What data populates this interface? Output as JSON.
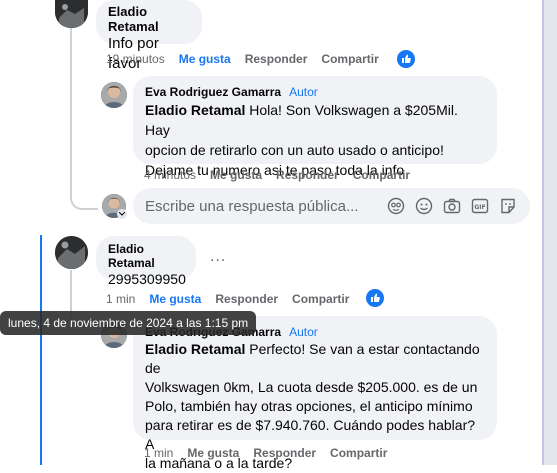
{
  "comments": [
    {
      "author": "Eladio Retamal",
      "text": "Info por favor",
      "time": "19 minutos",
      "like": "Me gusta",
      "reply": "Responder",
      "share": "Compartir"
    },
    {
      "author": "Eva Rodriguez Gamarra",
      "badge": "Autor",
      "mention": "Eladio Retamal",
      "text_lines": [
        " Hola! Son Volkswagen a $205Mil. Hay",
        "opcion de retirarlo con un auto usado o anticipo!",
        "Dejame tu numero asi te paso toda la info"
      ],
      "time": "4 minutos",
      "like": "Me gusta",
      "reply": "Responder",
      "share": "Compartir"
    },
    {
      "author": "Eladio Retamal",
      "text": "2995309950",
      "more": "...",
      "time": "1 min",
      "like": "Me gusta",
      "reply": "Responder",
      "share": "Compartir"
    },
    {
      "author": "Eva Rodriguez Gamarra",
      "badge": "Autor",
      "mention": "Eladio Retamal",
      "text_lines": [
        " Perfecto! Se van a estar contactando de",
        "Volkswagen 0km, La cuota desde $205.000. es de un",
        "Polo, también hay otras opciones, el anticipo mínimo",
        "para retirar es de $7.940.760. Cuándo podes hablar? A",
        "la mañana o a la tarde?"
      ],
      "time": "1 min",
      "like": "Me gusta",
      "reply": "Responder",
      "share": "Compartir"
    }
  ],
  "reply_box": {
    "placeholder": "Escribe una respuesta pública..."
  },
  "tooltip": "lunes, 4 de noviembre de 2024 a las 1:15 pm",
  "icons": [
    "avatar-sticker-icon",
    "emoji-icon",
    "camera-icon",
    "gif-icon",
    "sticker-icon",
    "like-reaction-icon"
  ],
  "colors": {
    "accent": "#1877f2",
    "bubble": "#f0f2f5",
    "meta": "#65676b"
  }
}
